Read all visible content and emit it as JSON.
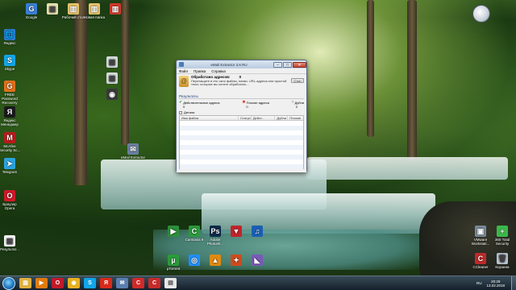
{
  "desktop_icons_left": [
    {
      "label": "Яндекс",
      "color": "#2a7fd4",
      "glyph": "🌐"
    },
    {
      "label": "Skype",
      "color": "#12a5e8",
      "glyph": "S"
    },
    {
      "label": "FREE Password Recovery",
      "color": "#e0701a",
      "glyph": "G"
    },
    {
      "label": "Яндекс Менеджер",
      "color": "#1a1a1a",
      "glyph": "Я"
    },
    {
      "label": "McAfee Security Sc...",
      "color": "#b81c1c",
      "glyph": "M"
    },
    {
      "label": "Telegram",
      "color": "#2aa3de",
      "glyph": "➤"
    },
    {
      "label": "Браузер Opera",
      "color": "#d01a2a",
      "glyph": "O"
    },
    {
      "label": "Результат...",
      "color": "#f4f4f4",
      "glyph": "▤"
    }
  ],
  "desktop_icons_top": [
    {
      "label": "Google",
      "color": "#3a7fd6",
      "glyph": "G"
    },
    {
      "label": "",
      "color": "#e8e0b0",
      "glyph": "▥"
    },
    {
      "label": "Рабочий стол",
      "color": "#e8c36a",
      "glyph": "▥"
    },
    {
      "label": "Новая папка",
      "color": "#e8c36a",
      "glyph": "▥"
    },
    {
      "label": "",
      "color": "#d23a2a",
      "glyph": "▥"
    }
  ],
  "desktop_icons_mid": [
    {
      "label": "",
      "color": "#d5d9de",
      "glyph": "▦"
    },
    {
      "label": "",
      "color": "#d5d9de",
      "glyph": "▦"
    },
    {
      "label": "",
      "color": "#3a3a3a",
      "glyph": "◉"
    },
    {
      "label": "eMail Extractor",
      "color": "#6a7fa0",
      "glyph": "✉"
    }
  ],
  "desktop_icons_bottom_row1": [
    {
      "label": "",
      "color": "#2d8f3a",
      "glyph": "▶"
    },
    {
      "label": "Camtasia 9",
      "color": "#2b9a3a",
      "glyph": "C"
    },
    {
      "label": "Adobe Photosh...",
      "color": "#0e2a4a",
      "glyph": "Ps"
    },
    {
      "label": "",
      "color": "#c0242a",
      "glyph": "▼"
    },
    {
      "label": "",
      "color": "#1a5fb4",
      "glyph": "♫"
    }
  ],
  "desktop_icons_bottom_row2": [
    {
      "label": "µTorrent",
      "color": "#2a9a3a",
      "glyph": "µ"
    },
    {
      "label": "",
      "color": "#1e90ff",
      "glyph": "◎"
    },
    {
      "label": "",
      "color": "#e08a10",
      "glyph": "▲"
    },
    {
      "label": "",
      "color": "#d04a1a",
      "glyph": "✦"
    },
    {
      "label": "",
      "color": "#7a5ab8",
      "glyph": "◣"
    }
  ],
  "desktop_icons_right": [
    {
      "label": "VMware Workstati...",
      "color": "#7a8a9a",
      "glyph": "▣"
    },
    {
      "label": "360 Total Security",
      "color": "#3ab84a",
      "glyph": "+"
    },
    {
      "label": "CCleaner",
      "color": "#c02a2a",
      "glyph": "C"
    },
    {
      "label": "Корзина",
      "color": "#b8c4d0",
      "glyph": "🗑"
    }
  ],
  "window": {
    "title": "eMail Extractor 3.6 RU",
    "minimize": "–",
    "maximize": "□",
    "close": "✕",
    "menu": [
      "Файл",
      "Правка",
      "Справка"
    ],
    "processed_label": "Обработано адресов:",
    "processed_count": "0",
    "hint": "Перетащите в это окно файлы, папки, URL-адреса или простой текст, которые вы хотите обработать...",
    "stop_button": "Стоп",
    "results_label": "Результаты",
    "stats": [
      {
        "mark": "✔",
        "mark_color": "#2a9a2a",
        "label": "Действительные адреса",
        "value": "0"
      },
      {
        "mark": "✖",
        "mark_color": "#d02a1a",
        "label": "Плохие адреса",
        "value": "0"
      },
      {
        "mark": "≈",
        "mark_color": "#5a6a8a",
        "label": "Дубли",
        "value": "0"
      }
    ],
    "details_label": "Детали",
    "columns": [
      "Имя файла",
      "Статус",
      "Дейст...",
      "Дубли",
      "Плохие"
    ]
  },
  "taskbar": {
    "items": [
      {
        "name": "explorer",
        "color": "#e0b040",
        "glyph": "▥"
      },
      {
        "name": "media-player",
        "color": "#e07a10",
        "glyph": "▶"
      },
      {
        "name": "opera",
        "color": "#c01a2a",
        "glyph": "O"
      },
      {
        "name": "chrome",
        "color": "#e8b020",
        "glyph": "◉"
      },
      {
        "name": "skype",
        "color": "#12a5e8",
        "glyph": "S"
      },
      {
        "name": "yandex",
        "color": "#d82a1a",
        "glyph": "Я"
      },
      {
        "name": "emailextractor",
        "color": "#5a7fb0",
        "glyph": "✉"
      },
      {
        "name": "camtasia",
        "color": "#d02a2a",
        "glyph": "C"
      },
      {
        "name": "camtasia-2",
        "color": "#c62a2a",
        "glyph": "C"
      },
      {
        "name": "document",
        "color": "#e8e8e8",
        "glyph": "▤"
      }
    ],
    "language": "RU",
    "time": "20:29",
    "date": "13.02.2018"
  }
}
